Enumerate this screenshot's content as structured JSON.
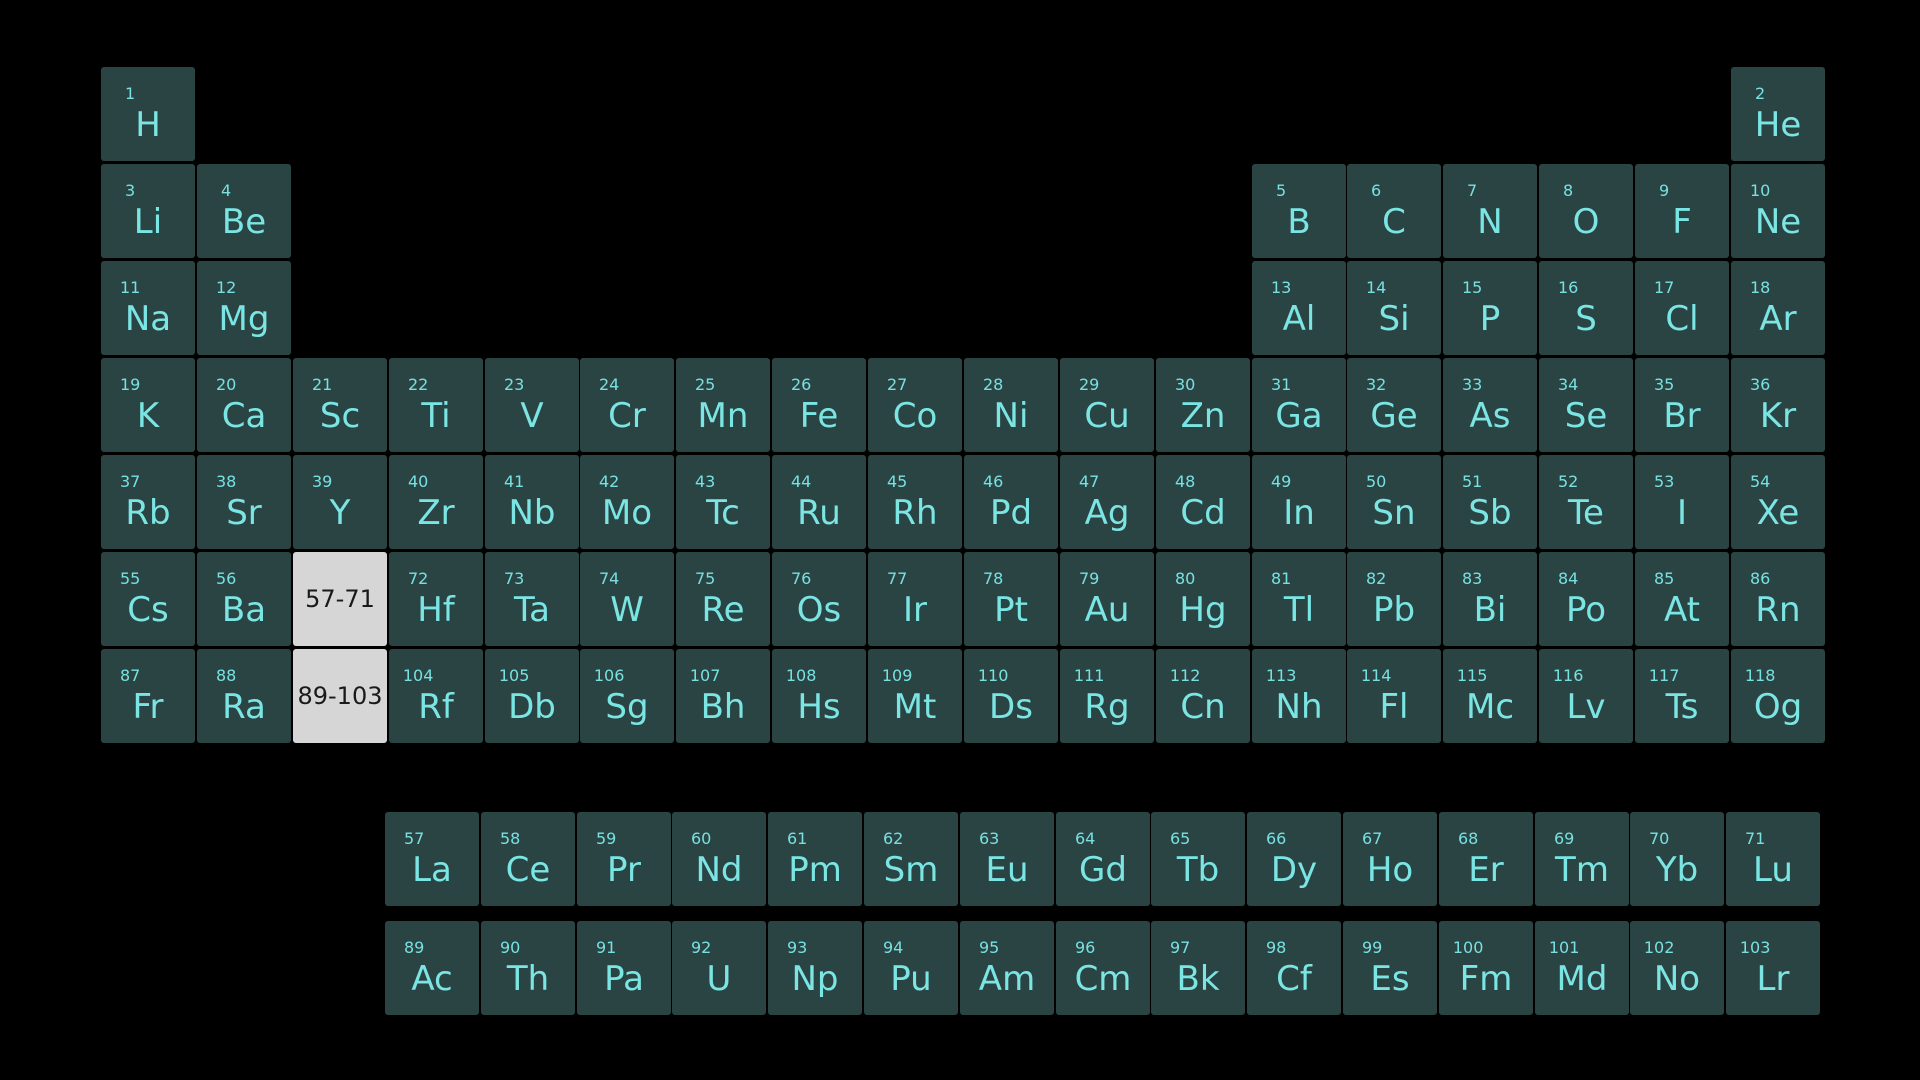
{
  "colors": {
    "background": "#000000",
    "cell": "#2a4444",
    "text": "#7be5e3",
    "placeholder": "#d6d6d6",
    "placeholder_text": "#1a1a1a"
  },
  "main_table": [
    [
      "1",
      "H",
      1,
      1
    ],
    [
      "2",
      "He",
      18,
      1
    ],
    [
      "3",
      "Li",
      1,
      2
    ],
    [
      "4",
      "Be",
      2,
      2
    ],
    [
      "5",
      "B",
      13,
      2
    ],
    [
      "6",
      "C",
      14,
      2
    ],
    [
      "7",
      "N",
      15,
      2
    ],
    [
      "8",
      "O",
      16,
      2
    ],
    [
      "9",
      "F",
      17,
      2
    ],
    [
      "10",
      "Ne",
      18,
      2
    ],
    [
      "11",
      "Na",
      1,
      3
    ],
    [
      "12",
      "Mg",
      2,
      3
    ],
    [
      "13",
      "Al",
      13,
      3
    ],
    [
      "14",
      "Si",
      14,
      3
    ],
    [
      "15",
      "P",
      15,
      3
    ],
    [
      "16",
      "S",
      16,
      3
    ],
    [
      "17",
      "Cl",
      17,
      3
    ],
    [
      "18",
      "Ar",
      18,
      3
    ],
    [
      "19",
      "K",
      1,
      4
    ],
    [
      "20",
      "Ca",
      2,
      4
    ],
    [
      "21",
      "Sc",
      3,
      4
    ],
    [
      "22",
      "Ti",
      4,
      4
    ],
    [
      "23",
      "V",
      5,
      4
    ],
    [
      "24",
      "Cr",
      6,
      4
    ],
    [
      "25",
      "Mn",
      7,
      4
    ],
    [
      "26",
      "Fe",
      8,
      4
    ],
    [
      "27",
      "Co",
      9,
      4
    ],
    [
      "28",
      "Ni",
      10,
      4
    ],
    [
      "29",
      "Cu",
      11,
      4
    ],
    [
      "30",
      "Zn",
      12,
      4
    ],
    [
      "31",
      "Ga",
      13,
      4
    ],
    [
      "32",
      "Ge",
      14,
      4
    ],
    [
      "33",
      "As",
      15,
      4
    ],
    [
      "34",
      "Se",
      16,
      4
    ],
    [
      "35",
      "Br",
      17,
      4
    ],
    [
      "36",
      "Kr",
      18,
      4
    ],
    [
      "37",
      "Rb",
      1,
      5
    ],
    [
      "38",
      "Sr",
      2,
      5
    ],
    [
      "39",
      "Y",
      3,
      5
    ],
    [
      "40",
      "Zr",
      4,
      5
    ],
    [
      "41",
      "Nb",
      5,
      5
    ],
    [
      "42",
      "Mo",
      6,
      5
    ],
    [
      "43",
      "Tc",
      7,
      5
    ],
    [
      "44",
      "Ru",
      8,
      5
    ],
    [
      "45",
      "Rh",
      9,
      5
    ],
    [
      "46",
      "Pd",
      10,
      5
    ],
    [
      "47",
      "Ag",
      11,
      5
    ],
    [
      "48",
      "Cd",
      12,
      5
    ],
    [
      "49",
      "In",
      13,
      5
    ],
    [
      "50",
      "Sn",
      14,
      5
    ],
    [
      "51",
      "Sb",
      15,
      5
    ],
    [
      "52",
      "Te",
      16,
      5
    ],
    [
      "53",
      "I",
      17,
      5
    ],
    [
      "54",
      "Xe",
      18,
      5
    ],
    [
      "55",
      "Cs",
      1,
      6
    ],
    [
      "56",
      "Ba",
      2,
      6
    ],
    [
      "72",
      "Hf",
      4,
      6
    ],
    [
      "73",
      "Ta",
      5,
      6
    ],
    [
      "74",
      "W",
      6,
      6
    ],
    [
      "75",
      "Re",
      7,
      6
    ],
    [
      "76",
      "Os",
      8,
      6
    ],
    [
      "77",
      "Ir",
      9,
      6
    ],
    [
      "78",
      "Pt",
      10,
      6
    ],
    [
      "79",
      "Au",
      11,
      6
    ],
    [
      "80",
      "Hg",
      12,
      6
    ],
    [
      "81",
      "Tl",
      13,
      6
    ],
    [
      "82",
      "Pb",
      14,
      6
    ],
    [
      "83",
      "Bi",
      15,
      6
    ],
    [
      "84",
      "Po",
      16,
      6
    ],
    [
      "85",
      "At",
      17,
      6
    ],
    [
      "86",
      "Rn",
      18,
      6
    ],
    [
      "87",
      "Fr",
      1,
      7
    ],
    [
      "88",
      "Ra",
      2,
      7
    ],
    [
      "104",
      "Rf",
      4,
      7
    ],
    [
      "105",
      "Db",
      5,
      7
    ],
    [
      "106",
      "Sg",
      6,
      7
    ],
    [
      "107",
      "Bh",
      7,
      7
    ],
    [
      "108",
      "Hs",
      8,
      7
    ],
    [
      "109",
      "Mt",
      9,
      7
    ],
    [
      "110",
      "Ds",
      10,
      7
    ],
    [
      "111",
      "Rg",
      11,
      7
    ],
    [
      "112",
      "Cn",
      12,
      7
    ],
    [
      "113",
      "Nh",
      13,
      7
    ],
    [
      "114",
      "Fl",
      14,
      7
    ],
    [
      "115",
      "Mc",
      15,
      7
    ],
    [
      "116",
      "Lv",
      16,
      7
    ],
    [
      "117",
      "Ts",
      17,
      7
    ],
    [
      "118",
      "Og",
      18,
      7
    ]
  ],
  "placeholders": [
    [
      "57-71",
      3,
      6
    ],
    [
      "89-103",
      3,
      7
    ]
  ],
  "lanthanides": [
    [
      "57",
      "La"
    ],
    [
      "58",
      "Ce"
    ],
    [
      "59",
      "Pr"
    ],
    [
      "60",
      "Nd"
    ],
    [
      "61",
      "Pm"
    ],
    [
      "62",
      "Sm"
    ],
    [
      "63",
      "Eu"
    ],
    [
      "64",
      "Gd"
    ],
    [
      "65",
      "Tb"
    ],
    [
      "66",
      "Dy"
    ],
    [
      "67",
      "Ho"
    ],
    [
      "68",
      "Er"
    ],
    [
      "69",
      "Tm"
    ],
    [
      "70",
      "Yb"
    ],
    [
      "71",
      "Lu"
    ]
  ],
  "actinides": [
    [
      "89",
      "Ac"
    ],
    [
      "90",
      "Th"
    ],
    [
      "91",
      "Pa"
    ],
    [
      "92",
      "U"
    ],
    [
      "93",
      "Np"
    ],
    [
      "94",
      "Pu"
    ],
    [
      "95",
      "Am"
    ],
    [
      "96",
      "Cm"
    ],
    [
      "97",
      "Bk"
    ],
    [
      "98",
      "Cf"
    ],
    [
      "99",
      "Es"
    ],
    [
      "100",
      "Fm"
    ],
    [
      "101",
      "Md"
    ],
    [
      "102",
      "No"
    ],
    [
      "103",
      "Lr"
    ]
  ]
}
